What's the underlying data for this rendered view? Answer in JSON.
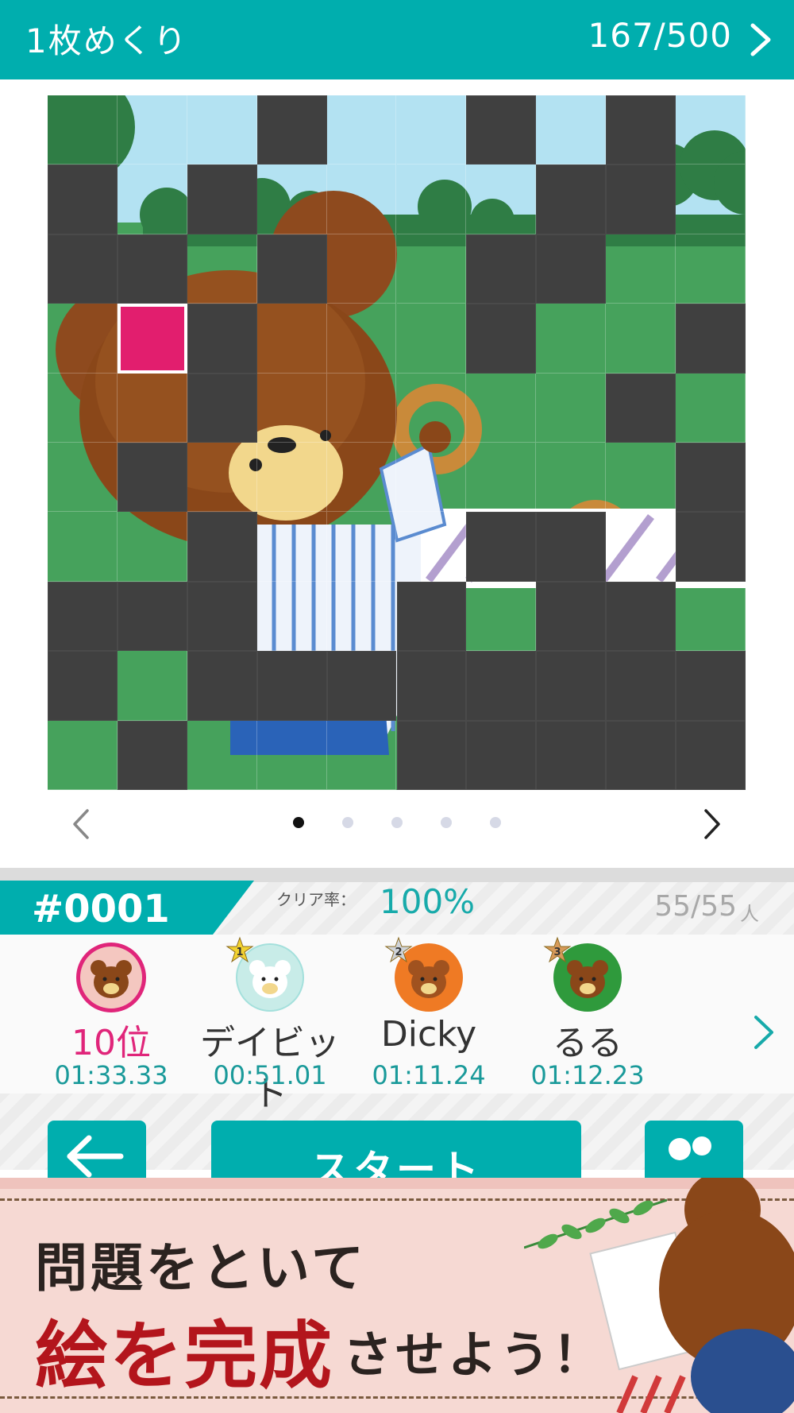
{
  "header": {
    "title": "1枚めくり",
    "progress": "167/500"
  },
  "puzzle": {
    "rows": 10,
    "cols": 10,
    "hidden_cells": [
      [
        0,
        3
      ],
      [
        0,
        6
      ],
      [
        0,
        8
      ],
      [
        1,
        0
      ],
      [
        1,
        2
      ],
      [
        1,
        7
      ],
      [
        1,
        8
      ],
      [
        2,
        0
      ],
      [
        2,
        1
      ],
      [
        2,
        3
      ],
      [
        2,
        6
      ],
      [
        2,
        7
      ],
      [
        3,
        2
      ],
      [
        3,
        6
      ],
      [
        3,
        9
      ],
      [
        4,
        2
      ],
      [
        4,
        8
      ],
      [
        5,
        1
      ],
      [
        5,
        9
      ],
      [
        6,
        2
      ],
      [
        6,
        6
      ],
      [
        6,
        7
      ],
      [
        6,
        9
      ],
      [
        7,
        0
      ],
      [
        7,
        1
      ],
      [
        7,
        2
      ],
      [
        7,
        5
      ],
      [
        7,
        7
      ],
      [
        7,
        8
      ],
      [
        8,
        0
      ],
      [
        8,
        2
      ],
      [
        8,
        3
      ],
      [
        8,
        4
      ],
      [
        8,
        5
      ],
      [
        8,
        6
      ],
      [
        8,
        7
      ],
      [
        8,
        8
      ],
      [
        8,
        9
      ],
      [
        9,
        1
      ],
      [
        9,
        5
      ],
      [
        9,
        6
      ],
      [
        9,
        7
      ],
      [
        9,
        8
      ],
      [
        9,
        9
      ]
    ],
    "selected_cell": [
      3,
      1
    ],
    "colors": {
      "hidden": "#404040",
      "selected": "#e21e6e",
      "sky": "#b3e2f2",
      "grass": "#46a25c"
    }
  },
  "pager": {
    "pages": 5,
    "active_page": 1
  },
  "stage": {
    "id": "#0001",
    "clear_rate_label": "クリア率：",
    "clear_rate": "100%",
    "players": "55/55",
    "players_unit": "人"
  },
  "ranking": [
    {
      "name": "10位",
      "time": "01:33.33",
      "rank_badge": "",
      "avatar": "bear-brown-icon",
      "ring": "#e0257a"
    },
    {
      "name": "デイビット",
      "time": "00:51.01",
      "rank_badge": "1",
      "avatar": "bear-white-icon",
      "ring": "#a4e0dc"
    },
    {
      "name": "Dicky",
      "time": "01:11.24",
      "rank_badge": "2",
      "avatar": "bear-orange-icon",
      "ring": "#ef7a24"
    },
    {
      "name": "るる",
      "time": "01:12.23",
      "rank_badge": "3",
      "avatar": "bear-red-icon",
      "ring": "#2f9a3c"
    }
  ],
  "buttons": {
    "start": "スタート"
  },
  "promo": {
    "line1": "問題をといて",
    "line2_emph": "絵を完成",
    "line2_rest": "させよう！"
  },
  "accent": "#00aeae"
}
